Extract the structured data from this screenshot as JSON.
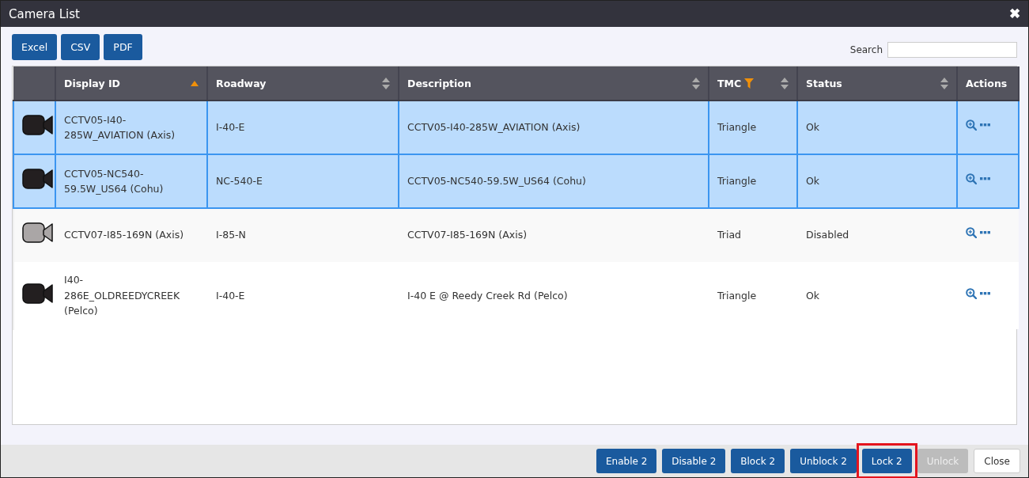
{
  "window": {
    "title": "Camera List",
    "close": "✖"
  },
  "export_buttons": [
    "Excel",
    "CSV",
    "PDF"
  ],
  "search": {
    "label": "Search"
  },
  "table": {
    "columns": [
      {
        "sortable": false,
        "sorted_ascending": false,
        "filtered": false
      },
      {
        "label": "Display ID",
        "sortable": true,
        "sorted_ascending": true,
        "filtered": false
      },
      {
        "label": "Roadway",
        "sortable": true,
        "sorted_ascending": false,
        "filtered": false
      },
      {
        "label": "Description",
        "sortable": true,
        "sorted_ascending": false,
        "filtered": false
      },
      {
        "label": "TMC",
        "sortable": true,
        "sorted_ascending": false,
        "filtered": true
      },
      {
        "label": "Status",
        "sortable": true,
        "sorted_ascending": false,
        "filtered": false
      },
      {
        "label": "Actions",
        "sortable": false,
        "sorted_ascending": false,
        "filtered": false
      }
    ],
    "rows": [
      {
        "selected": true,
        "camera_enabled": true,
        "display_id": "CCTV05-I40-285W_AVIATION (Axis)",
        "roadway": "I-40-E",
        "description": "CCTV05-I40-285W_AVIATION (Axis)",
        "tmc": "Triangle",
        "status": "Ok"
      },
      {
        "selected": true,
        "camera_enabled": true,
        "display_id": "CCTV05-NC540-59.5W_US64 (Cohu)",
        "roadway": "NC-540-E",
        "description": "CCTV05-NC540-59.5W_US64 (Cohu)",
        "tmc": "Triangle",
        "status": "Ok"
      },
      {
        "selected": false,
        "camera_enabled": false,
        "display_id": "CCTV07-I85-169N (Axis)",
        "roadway": "I-85-N",
        "description": "CCTV07-I85-169N (Axis)",
        "tmc": "Triad",
        "status": "Disabled"
      },
      {
        "selected": false,
        "camera_enabled": true,
        "display_id": "I40-286E_OLDREEDYCREEK (Pelco)",
        "roadway": "I-40-E",
        "description": "I-40 E @ Reedy Creek Rd (Pelco)",
        "tmc": "Triangle",
        "status": "Ok"
      }
    ]
  },
  "footer_buttons": [
    {
      "label": "Enable 2",
      "kind": "primary",
      "highlighted": false
    },
    {
      "label": "Disable 2",
      "kind": "primary",
      "highlighted": false
    },
    {
      "label": "Block 2",
      "kind": "primary",
      "highlighted": false
    },
    {
      "label": "Unblock 2",
      "kind": "primary",
      "highlighted": false
    },
    {
      "label": "Lock 2",
      "kind": "primary",
      "highlighted": true
    },
    {
      "label": "Unlock",
      "kind": "disabled",
      "highlighted": false
    },
    {
      "label": "Close",
      "kind": "default",
      "highlighted": false
    }
  ]
}
